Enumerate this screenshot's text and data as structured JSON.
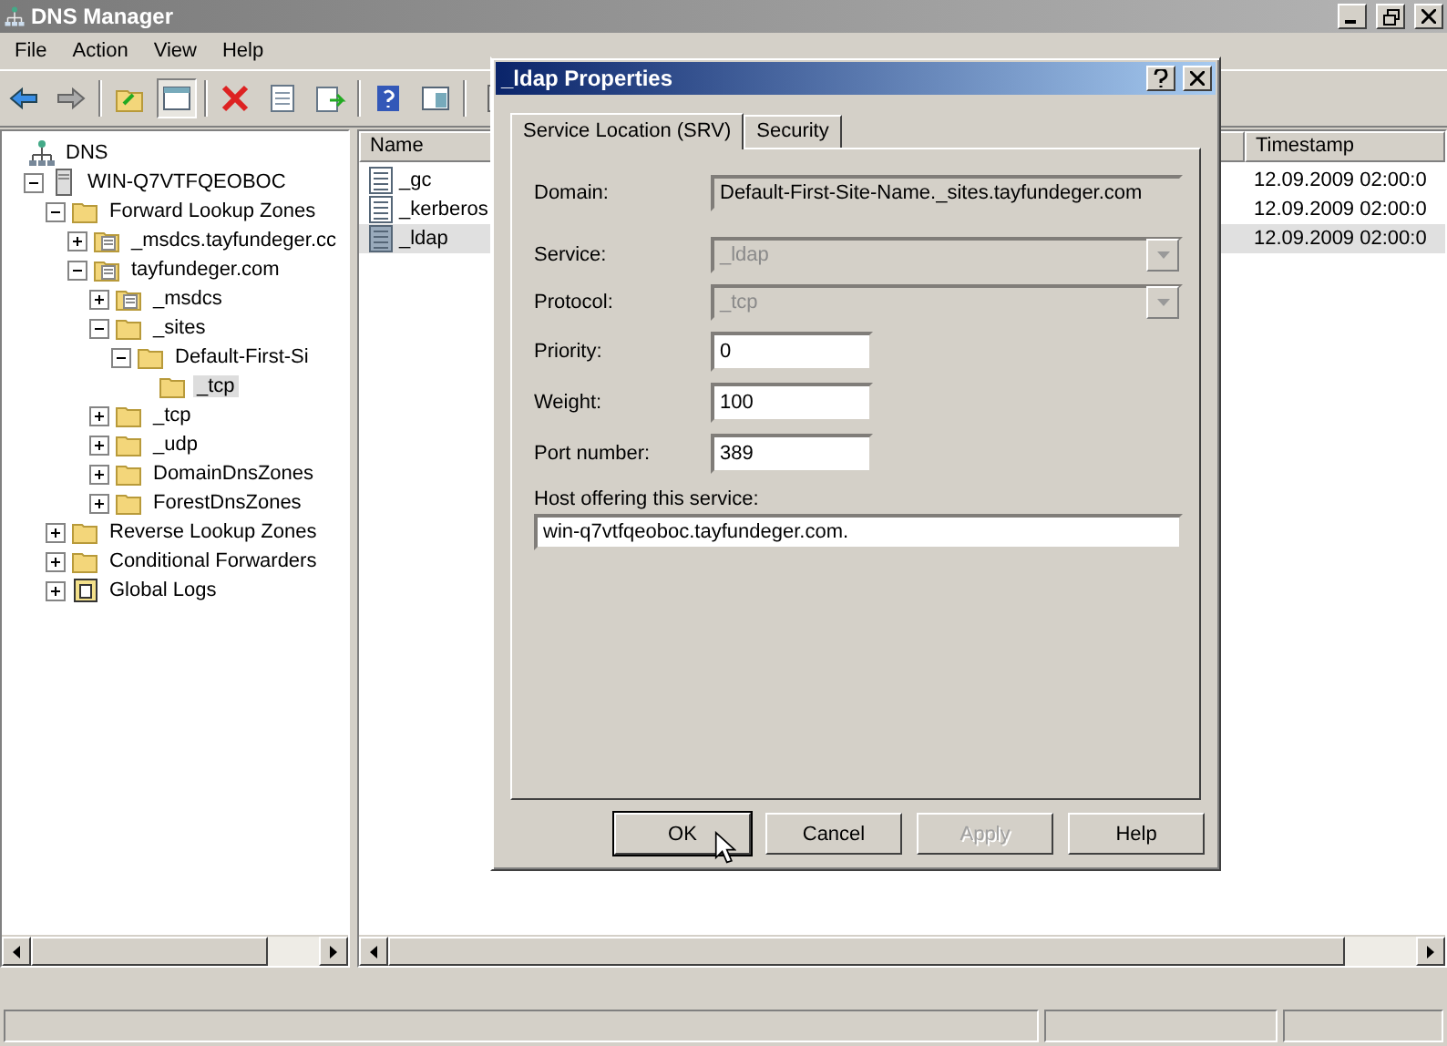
{
  "window": {
    "title": "DNS Manager"
  },
  "menu": [
    "File",
    "Action",
    "View",
    "Help"
  ],
  "tree": [
    {
      "label": "DNS",
      "kind": "dns",
      "selected": false,
      "children": [
        {
          "label": "WIN-Q7VTFQEOBOC",
          "kind": "server",
          "expanded": true,
          "selected": false,
          "children": [
            {
              "label": "Forward Lookup Zones",
              "kind": "folder",
              "expanded": true,
              "selected": false,
              "children": [
                {
                  "label": "_msdcs.tayfundeger.cc",
                  "kind": "zone",
                  "expanded": false,
                  "selected": false
                },
                {
                  "label": "tayfundeger.com",
                  "kind": "zone",
                  "expanded": true,
                  "selected": false,
                  "children": [
                    {
                      "label": "_msdcs",
                      "kind": "zone",
                      "expanded": false,
                      "selected": false
                    },
                    {
                      "label": "_sites",
                      "kind": "folder",
                      "expanded": true,
                      "selected": false,
                      "children": [
                        {
                          "label": "Default-First-Si",
                          "kind": "folder",
                          "expanded": true,
                          "selected": false,
                          "children": [
                            {
                              "label": "_tcp",
                              "kind": "folder",
                              "selected": true
                            }
                          ]
                        }
                      ]
                    },
                    {
                      "label": "_tcp",
                      "kind": "folder",
                      "expanded": false,
                      "selected": false
                    },
                    {
                      "label": "_udp",
                      "kind": "folder",
                      "expanded": false,
                      "selected": false
                    },
                    {
                      "label": "DomainDnsZones",
                      "kind": "folder",
                      "expanded": false,
                      "selected": false
                    },
                    {
                      "label": "ForestDnsZones",
                      "kind": "folder",
                      "expanded": false,
                      "selected": false
                    }
                  ]
                }
              ]
            },
            {
              "label": "Reverse Lookup Zones",
              "kind": "folder",
              "expanded": false,
              "selected": false
            },
            {
              "label": "Conditional Forwarders",
              "kind": "folder",
              "expanded": false,
              "selected": false
            },
            {
              "label": "Global Logs",
              "kind": "logs",
              "expanded": false,
              "selected": false
            }
          ]
        }
      ]
    }
  ],
  "list": {
    "columns": [
      "Name",
      "Timestamp"
    ],
    "rows": [
      {
        "name": "_gc",
        "timestamp": "12.09.2009 02:00:0",
        "selected": false
      },
      {
        "name": "_kerberos",
        "timestamp": "12.09.2009 02:00:0",
        "selected": false
      },
      {
        "name": "_ldap",
        "timestamp": "12.09.2009 02:00:0",
        "selected": true
      }
    ]
  },
  "dialog": {
    "title": "_ldap Properties",
    "tabs": [
      {
        "label": "Service Location (SRV)",
        "selected": true
      },
      {
        "label": "Security",
        "selected": false
      }
    ],
    "fields": [
      {
        "label": "Domain:",
        "value": "Default-First-Site-Name._sites.tayfundeger.com",
        "kind": "readonly"
      },
      {
        "label": "Service:",
        "value": "_ldap",
        "kind": "select"
      },
      {
        "label": "Protocol:",
        "value": "_tcp",
        "kind": "select"
      },
      {
        "label": "Priority:",
        "value": "0",
        "kind": "input"
      },
      {
        "label": "Weight:",
        "value": "100",
        "kind": "input"
      },
      {
        "label": "Port number:",
        "value": "389",
        "kind": "input"
      }
    ],
    "host": {
      "label": "Host offering this service:",
      "value": "win-q7vtfqeoboc.tayfundeger.com."
    },
    "buttons": [
      {
        "label": "OK",
        "default": true,
        "disabled": false
      },
      {
        "label": "Cancel",
        "default": false,
        "disabled": false
      },
      {
        "label": "Apply",
        "default": false,
        "disabled": true
      },
      {
        "label": "Help",
        "default": false,
        "disabled": false
      }
    ]
  }
}
